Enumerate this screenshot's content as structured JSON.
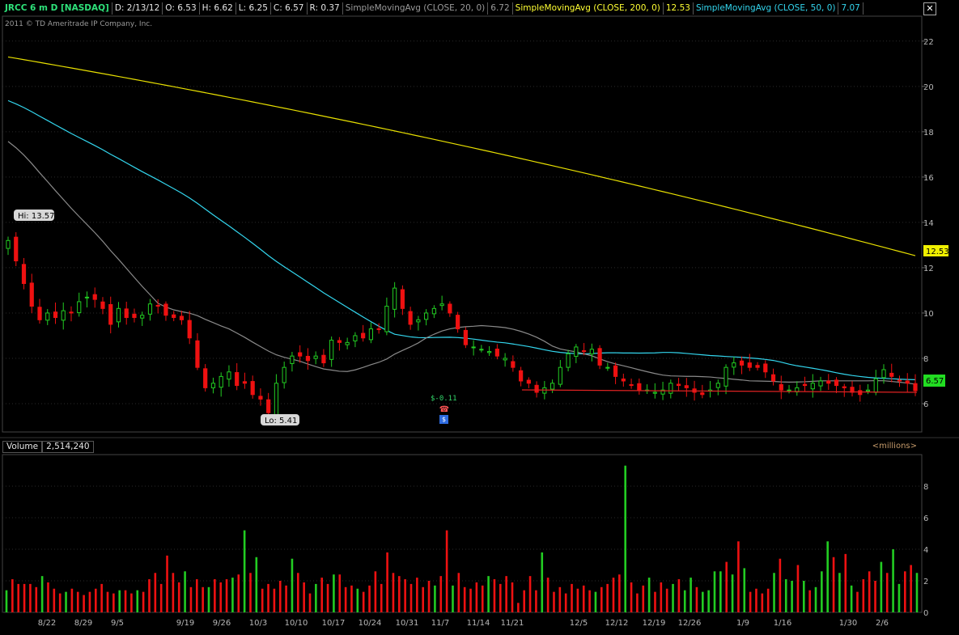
{
  "header": {
    "symbol": "JRCC 6 m D [NASDAQ]",
    "date": "D: 2/13/12",
    "open": "O: 6.53",
    "high": "H: 6.62",
    "low": "L: 6.25",
    "close": "C: 6.57",
    "range": "R: 0.37",
    "sma20_label": "SimpleMovingAvg (CLOSE, 20, 0)",
    "sma20_value": "6.72",
    "sma200_label": "SimpleMovingAvg (CLOSE, 200, 0)",
    "sma200_value": "12.53",
    "sma50_label": "SimpleMovingAvg (CLOSE, 50, 0)",
    "sma50_value": "7.07",
    "close_button": "✕"
  },
  "copyright": "2011 © TD Ameritrade IP Company, Inc.",
  "volume_panel": {
    "label": "Volume",
    "value": "2,514,240",
    "units": "<millions>"
  },
  "events": {
    "dividend": "$-0.11",
    "phone_icon": "phone-icon",
    "earnings_icon": "earnings-icon"
  },
  "colors": {
    "up": "#22cc22",
    "down": "#ee1111",
    "sma20": "#8a8a8a",
    "sma50": "#33d6ee",
    "sma200": "#e8e000",
    "support": "#dd2222",
    "grid": "#2a2a2a",
    "axis_text": "#b8b8b8"
  },
  "chart_data": {
    "type": "candlestick",
    "price_axis": {
      "ticks": [
        6,
        8,
        10,
        12,
        14,
        16,
        18,
        20,
        22
      ],
      "ylim": [
        4.75,
        23.1
      ]
    },
    "volume_axis": {
      "ticks": [
        0,
        2,
        4,
        6,
        8
      ],
      "unit": "millions",
      "ylim": [
        0,
        10
      ]
    },
    "x_labels": [
      "8/22",
      "8/29",
      "9/5",
      "9/19",
      "9/26",
      "10/3",
      "10/10",
      "10/17",
      "10/24",
      "10/31",
      "11/7",
      "11/14",
      "11/21",
      "12/5",
      "12/12",
      "12/19",
      "12/26",
      "1/9",
      "1/16",
      "1/30",
      "2/6"
    ],
    "high_label": "Hi: 13.57",
    "low_label": "Lo: 5.41",
    "last_close_label": "6.57",
    "sma200_label": "12.53",
    "closes": [
      13.2,
      12.3,
      11.3,
      10.3,
      9.7,
      10.0,
      9.8,
      10.1,
      10.0,
      10.5,
      10.7,
      10.6,
      10.2,
      9.5,
      10.2,
      9.8,
      9.8,
      9.9,
      10.4,
      10.3,
      9.9,
      9.8,
      9.7,
      8.9,
      7.6,
      6.7,
      6.9,
      7.2,
      7.4,
      6.8,
      6.9,
      6.4,
      6.2,
      5.6,
      6.9,
      7.6,
      8.1,
      8.1,
      7.9,
      8.1,
      7.8,
      8.8,
      8.7,
      8.7,
      9.0,
      8.9,
      9.3,
      9.3,
      10.3,
      11.1,
      10.2,
      9.5,
      9.7,
      10.0,
      10.2,
      10.4,
      10.0,
      9.3,
      8.6,
      8.5,
      8.4,
      8.3,
      8.1,
      8.0,
      7.6,
      7.0,
      6.9,
      6.5,
      6.7,
      6.9,
      7.6,
      8.2,
      8.5,
      8.3,
      8.4,
      7.7,
      7.6,
      7.2,
      7.0,
      6.8,
      6.6,
      6.6,
      6.5,
      6.6,
      6.9,
      6.8,
      6.7,
      6.5,
      6.4,
      6.6,
      6.9,
      7.6,
      7.8,
      7.7,
      7.6,
      7.6,
      7.4,
      7.0,
      6.6,
      6.6,
      6.7,
      6.8,
      6.9,
      7.0,
      6.9,
      6.8,
      6.7,
      6.5,
      6.4,
      6.6,
      7.1,
      7.5,
      7.2,
      7.0,
      6.9,
      6.57
    ],
    "volumes": [
      1.4,
      2.1,
      1.8,
      1.8,
      1.8,
      1.6,
      2.3,
      1.9,
      1.5,
      1.2,
      1.3,
      1.5,
      1.3,
      1.1,
      1.3,
      1.5,
      1.8,
      1.3,
      1.2,
      1.4,
      1.4,
      1.2,
      1.4,
      1.3,
      2.1,
      2.5,
      1.8,
      3.6,
      2.5,
      1.9,
      2.6,
      1.6,
      2.1,
      1.6,
      1.6,
      2.1,
      1.9,
      2.1,
      2.2,
      2.4,
      5.2,
      2.5,
      3.5,
      1.5,
      1.8,
      1.5,
      2.0,
      1.7,
      3.4,
      2.5,
      1.9,
      1.2,
      1.8,
      2.2,
      1.8,
      2.4,
      2.4,
      1.6,
      1.7,
      1.5,
      1.3,
      1.7,
      2.6,
      1.8,
      3.8,
      2.5,
      2.3,
      2.1,
      1.8,
      2.2,
      1.6,
      2.0,
      1.7,
      2.3,
      5.2,
      1.7,
      2.5,
      1.6,
      1.5,
      1.9,
      1.7,
      2.3,
      2.1,
      1.8,
      2.3,
      1.9,
      0.6,
      1.4,
      2.3,
      1.4,
      3.8,
      2.2,
      1.3,
      1.6,
      1.2,
      1.8,
      1.5,
      1.7,
      1.4,
      1.3,
      1.6,
      1.8,
      2.2,
      2.4,
      9.3,
      1.9,
      1.2,
      1.7,
      2.2,
      1.3,
      1.9,
      1.5,
      1.8,
      2.1,
      1.4,
      2.2,
      1.6,
      1.3,
      1.4,
      2.6,
      2.6,
      3.2,
      2.4,
      4.5,
      2.8,
      1.3,
      1.5,
      1.2,
      1.5,
      2.5,
      3.4,
      2.1,
      2.0,
      3.0,
      2.0,
      1.4,
      1.6,
      2.6,
      4.5,
      3.5,
      2.5,
      3.7,
      1.7,
      1.3,
      2.1,
      2.6,
      2.0,
      3.2,
      2.5,
      4.0,
      1.8,
      2.6,
      3.0,
      2.5
    ],
    "volume_up": [
      true,
      false,
      false,
      false,
      false,
      false,
      true,
      false,
      false,
      false,
      true,
      false,
      false,
      false,
      false,
      false,
      false,
      false,
      false,
      true,
      false,
      false,
      true,
      false,
      false,
      false,
      false,
      false,
      false,
      false,
      true,
      false,
      false,
      false,
      true,
      false,
      false,
      false,
      true,
      false,
      true,
      false,
      true,
      false,
      false,
      false,
      false,
      false,
      true,
      false,
      false,
      false,
      true,
      false,
      false,
      true,
      false,
      false,
      false,
      true,
      false,
      false,
      false,
      false,
      false,
      false,
      false,
      false,
      false,
      false,
      false,
      false,
      true,
      false,
      false,
      true,
      false,
      false,
      false,
      false,
      false,
      true,
      false,
      false,
      false,
      false,
      false,
      false,
      false,
      false,
      true,
      false,
      false,
      false,
      false,
      false,
      false,
      false,
      false,
      true,
      false,
      false,
      false,
      false,
      true,
      false,
      false,
      false,
      true,
      false,
      false,
      false,
      true,
      false,
      true,
      true,
      false,
      true,
      true,
      true,
      true,
      false,
      true,
      false,
      true,
      false,
      false,
      false,
      false,
      true,
      false,
      true,
      true,
      false,
      true,
      false,
      true,
      true,
      true,
      false,
      true,
      false,
      true,
      false,
      false,
      false,
      false,
      true,
      false,
      true,
      true,
      false,
      false,
      true
    ]
  }
}
